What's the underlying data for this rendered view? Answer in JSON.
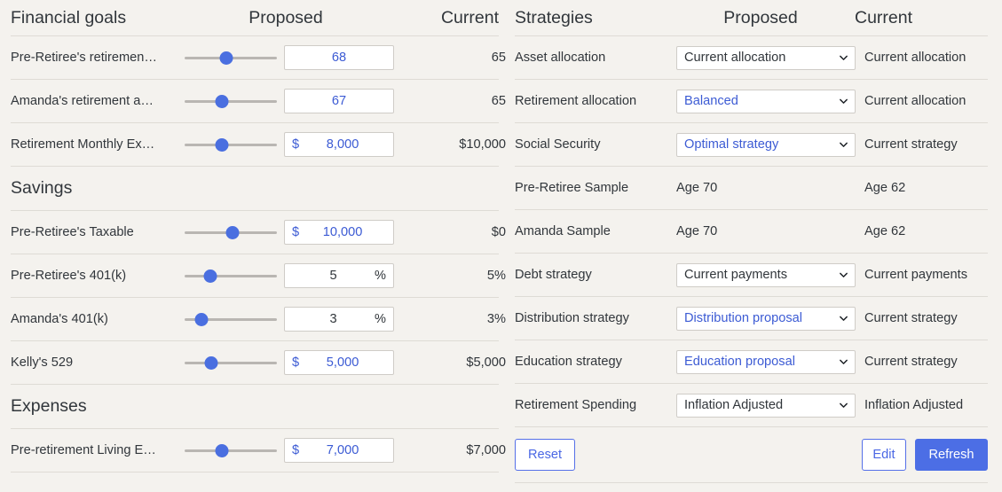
{
  "colors": {
    "background": "#f4f2ee",
    "accent": "#4c6ee5",
    "changed_text": "#3c5bd4",
    "text": "#31363b",
    "divider": "#dedbd5",
    "field_border": "#cfccc7",
    "slider_track": "#b9b6b2",
    "slider_thumb": "#4a6fe0"
  },
  "left": {
    "header": {
      "title": "Financial goals",
      "proposed": "Proposed",
      "current": "Current"
    },
    "sections": [
      {
        "name": "",
        "rows": [
          {
            "label": "Pre-Retiree's retiremen…",
            "slider_pct": 45,
            "prefix": "",
            "value": "68",
            "suffix": "",
            "changed": true,
            "current": "65"
          },
          {
            "label": "Amanda's retirement a…",
            "slider_pct": 40,
            "prefix": "",
            "value": "67",
            "suffix": "",
            "changed": true,
            "current": "65"
          },
          {
            "label": "Retirement Monthly Ex…",
            "slider_pct": 40,
            "prefix": "$",
            "value": "8,000",
            "suffix": "",
            "changed": true,
            "current": "$10,000"
          }
        ]
      },
      {
        "name": "Savings",
        "rows": [
          {
            "label": "Pre-Retiree's Taxable",
            "slider_pct": 52,
            "prefix": "$",
            "value": "10,000",
            "suffix": "",
            "changed": true,
            "current": "$0"
          },
          {
            "label": "Pre-Retiree's 401(k)",
            "slider_pct": 28,
            "prefix": "",
            "value": "5",
            "suffix": "%",
            "changed": false,
            "current": "5%"
          },
          {
            "label": "Amanda's 401(k)",
            "slider_pct": 18,
            "prefix": "",
            "value": "3",
            "suffix": "%",
            "changed": false,
            "current": "3%"
          },
          {
            "label": "Kelly's 529",
            "slider_pct": 29,
            "prefix": "$",
            "value": "5,000",
            "suffix": "",
            "changed": true,
            "current": "$5,000"
          }
        ]
      },
      {
        "name": "Expenses",
        "rows": [
          {
            "label": "Pre-retirement Living E…",
            "slider_pct": 40,
            "prefix": "$",
            "value": "7,000",
            "suffix": "",
            "changed": true,
            "current": "$7,000"
          }
        ]
      }
    ]
  },
  "right": {
    "header": {
      "title": "Strategies",
      "proposed": "Proposed",
      "current": "Current"
    },
    "rows": [
      {
        "label": "Asset allocation",
        "control": "select",
        "value": "Current allocation",
        "changed": false,
        "current": "Current allocation"
      },
      {
        "label": "Retirement allocation",
        "control": "select",
        "value": "Balanced",
        "changed": true,
        "current": "Current allocation"
      },
      {
        "label": "Social Security",
        "control": "select",
        "value": "Optimal strategy",
        "changed": true,
        "current": "Current strategy"
      },
      {
        "label": "Pre-Retiree Sample",
        "control": "text",
        "value": "Age 70",
        "changed": false,
        "current": "Age 62"
      },
      {
        "label": "Amanda Sample",
        "control": "text",
        "value": "Age 70",
        "changed": false,
        "current": "Age 62"
      },
      {
        "label": "Debt strategy",
        "control": "select",
        "value": "Current payments",
        "changed": false,
        "current": "Current payments"
      },
      {
        "label": "Distribution strategy",
        "control": "select",
        "value": "Distribution proposal",
        "changed": true,
        "current": "Current strategy"
      },
      {
        "label": "Education strategy",
        "control": "select",
        "value": "Education proposal",
        "changed": true,
        "current": "Current strategy"
      },
      {
        "label": "Retirement Spending",
        "control": "select",
        "value": "Inflation Adjusted",
        "changed": false,
        "current": "Inflation Adjusted"
      }
    ],
    "buttons": {
      "reset": "Reset",
      "edit": "Edit",
      "refresh": "Refresh"
    }
  },
  "icons": {
    "chevron_down": "chevron-down-icon"
  }
}
